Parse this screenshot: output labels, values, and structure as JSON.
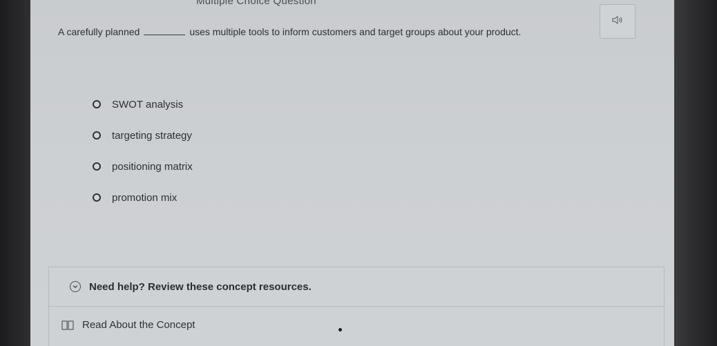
{
  "header": {
    "title": "Multiple Choice Question"
  },
  "question": {
    "text_before": "A carefully planned",
    "text_after": "uses multiple tools to inform customers and target groups about your product."
  },
  "options": [
    {
      "label": "SWOT analysis"
    },
    {
      "label": "targeting strategy"
    },
    {
      "label": "positioning matrix"
    },
    {
      "label": "promotion mix"
    }
  ],
  "help": {
    "title": "Need help? Review these concept resources.",
    "resource_label": "Read About the Concept"
  },
  "icons": {
    "audio": "speaker-icon",
    "expand": "chevron-down-circle-icon",
    "resource": "book-icon"
  }
}
